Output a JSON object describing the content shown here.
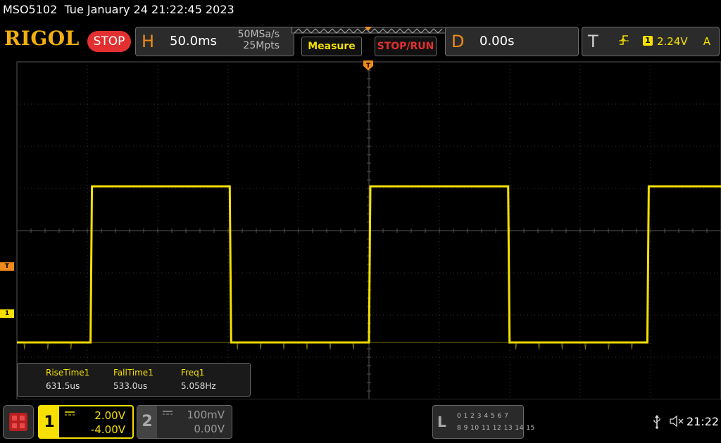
{
  "status": {
    "model": "MSO5102",
    "datetime": "Tue January 24 21:22:45 2023"
  },
  "header": {
    "logo": "RIGOL",
    "run_state": "STOP",
    "horizontal": {
      "letter": "H",
      "timebase": "50.0ms",
      "sample_rate": "50MSa/s",
      "memory_depth": "25Mpts"
    },
    "measure_label": "Measure",
    "stoprun_label": "STOP/RUN",
    "delay": {
      "letter": "D",
      "value": "0.00s"
    },
    "trigger": {
      "letter": "T",
      "source": "1",
      "level": "2.24V",
      "mode": "A"
    }
  },
  "markers": {
    "trigger": "T",
    "channel1": "1"
  },
  "measurements": [
    {
      "name": "RiseTime1",
      "value": "631.5us"
    },
    {
      "name": "FallTime1",
      "value": "533.0us"
    },
    {
      "name": "Freq1",
      "value": "5.058Hz"
    }
  ],
  "channels": [
    {
      "number": "1",
      "scale": "2.00V",
      "offset": "-4.00V"
    },
    {
      "number": "2",
      "scale": "100mV",
      "offset": "0.00V"
    }
  ],
  "logic": {
    "letter": "L",
    "row1": "0 1 2 3  4 5 6 7",
    "row2": "8 9 10 11 12 13 14 15"
  },
  "clock": "21:22",
  "colors": {
    "ch1": "#f5e000",
    "trigger": "#f08a1a",
    "stop": "#e23030",
    "logo": "#f2b010"
  },
  "waveform": {
    "frequency_hz": 5.058,
    "rise_time_us": 631.5,
    "fall_time_us": 533.0,
    "high_level_div": 5.05,
    "low_level_div": 1.35
  }
}
